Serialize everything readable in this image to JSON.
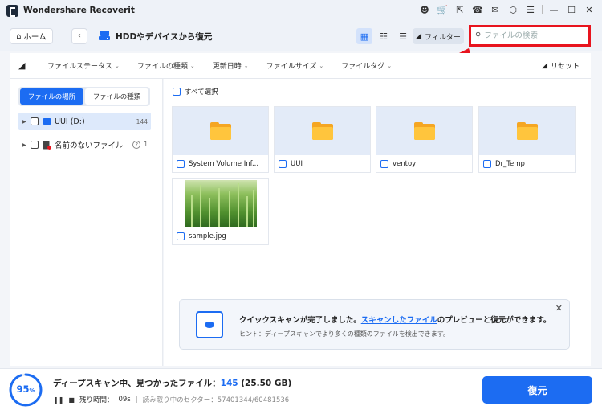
{
  "app": {
    "title": "Wondershare Recoverit"
  },
  "toolbar": {
    "home_label": "ホーム",
    "location_title": "HDDやデバイスから復元",
    "filter_label": "フィルター",
    "search_placeholder": "ファイルの検索"
  },
  "filterbar": {
    "items": [
      "ファイルステータス",
      "ファイルの種類",
      "更新日時",
      "ファイルサイズ",
      "ファイルタグ"
    ],
    "reset_label": "リセット"
  },
  "sidebar": {
    "tabs": [
      "ファイルの場所",
      "ファイルの種類"
    ],
    "tree": [
      {
        "label": "UUI (D:)",
        "count": "144"
      },
      {
        "label": "名前のないファイル",
        "count": "1"
      }
    ]
  },
  "main": {
    "select_all": "すべて選択",
    "files": [
      {
        "name": "System Volume Inf...",
        "type": "folder"
      },
      {
        "name": "UUI",
        "type": "folder"
      },
      {
        "name": "ventoy",
        "type": "folder"
      },
      {
        "name": "Dr_Temp",
        "type": "folder"
      },
      {
        "name": "sample.jpg",
        "type": "image"
      }
    ]
  },
  "notice": {
    "main_prefix": "クイックスキャンが完了しました。",
    "main_link": "スキャンしたファイル",
    "main_suffix": "のプレビューと復元ができます。",
    "hint": "ヒント：ディープスキャンでより多くの種類のファイルを検出できます。"
  },
  "status": {
    "progress": "95",
    "progress_unit": "%",
    "progress_fraction": 0.95,
    "scan_text": "ディープスキャン中、見つかったファイル：",
    "found_count": "145",
    "found_size": "(25.50 GB)",
    "remaining_label": "残り時間：",
    "remaining_value": "09s",
    "sectors_label": "読み取り中のセクター：57401344/60481536"
  },
  "actions": {
    "recover_label": "復元"
  },
  "colors": {
    "accent": "#1c6cf2",
    "highlight": "#e8141e",
    "folder": "#ffc53d"
  }
}
